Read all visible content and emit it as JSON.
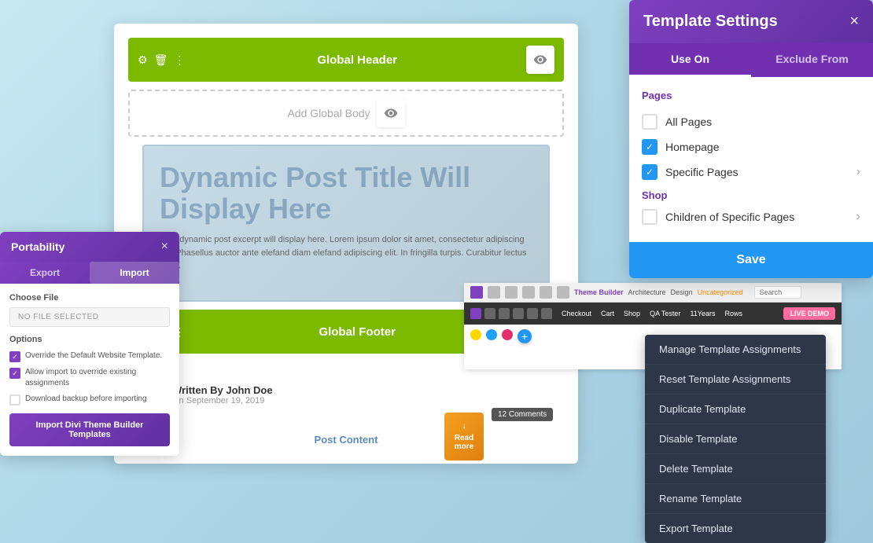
{
  "canvas": {
    "bg_color": "#c8e8f0"
  },
  "builder_card": {
    "rows": [
      {
        "id": "header",
        "label": "Global Header",
        "active": true
      },
      {
        "id": "body",
        "label": "Add Global Body",
        "active": false
      },
      {
        "id": "footer",
        "label": "Global Footer",
        "active": true
      }
    ],
    "dynamic_title": "Dynamic Post Title Will Display Here",
    "dynamic_excerpt": "Your dynamic post excerpt will display here. Lorem ipsum dolor sit amet, consectetur adipiscing elit. Phasellus auctor ante elefand diam elefand adipiscing elit. In fringilla turpis. Curabitur lectus enim.",
    "author": {
      "name": "Written By John Doe",
      "date": "On September 19, 2019"
    },
    "post_content": "Post Content"
  },
  "portability": {
    "title": "Portability",
    "close_label": "×",
    "tabs": [
      {
        "id": "export",
        "label": "Export"
      },
      {
        "id": "import",
        "label": "Import"
      }
    ],
    "file_section_label": "Choose File",
    "file_placeholder": "NO FILE SELECTED",
    "options_label": "Options",
    "options": [
      {
        "id": "override",
        "label": "Override the Default Website Template.",
        "checked": true
      },
      {
        "id": "allow_import",
        "label": "Allow import to override existing assignments",
        "checked": true
      },
      {
        "id": "download_backup",
        "label": "Download backup before importing",
        "checked": false
      }
    ],
    "import_btn_label": "Import Divi Theme Builder Templates"
  },
  "template_settings": {
    "title": "Template Settings",
    "close_label": "×",
    "tabs": [
      {
        "id": "use_on",
        "label": "Use On",
        "active": true
      },
      {
        "id": "exclude_from",
        "label": "Exclude From",
        "active": false
      }
    ],
    "pages_section": "Pages",
    "pages": [
      {
        "id": "all_pages",
        "label": "All Pages",
        "checked": false
      },
      {
        "id": "homepage",
        "label": "Homepage",
        "checked": true
      },
      {
        "id": "specific_pages",
        "label": "Specific Pages",
        "checked": true,
        "has_arrow": true
      }
    ],
    "shop_section": "Shop",
    "shop_items": [
      {
        "id": "children_specific",
        "label": "Children of Specific Pages",
        "checked": false,
        "has_arrow": true
      }
    ],
    "save_btn": "Save"
  },
  "context_menu": {
    "items": [
      {
        "id": "manage_assignments",
        "label": "Manage Template Assignments"
      },
      {
        "id": "reset_assignments",
        "label": "Reset Template Assignments"
      },
      {
        "id": "duplicate",
        "label": "Duplicate Template"
      },
      {
        "id": "disable",
        "label": "Disable Template"
      },
      {
        "id": "delete",
        "label": "Delete Template"
      },
      {
        "id": "rename",
        "label": "Rename Template"
      },
      {
        "id": "export",
        "label": "Export Template"
      }
    ]
  },
  "demo_bar": {
    "nav_icons": [
      "home-icon",
      "theme-builder-label",
      "architecture-label",
      "design-label",
      "uncategorized-label"
    ],
    "nav_labels": [
      "Theme Builder",
      "Architecture",
      "Design",
      "Uncategorized"
    ],
    "search_placeholder": "Search",
    "menu_items": [
      "Checkout",
      "Cart",
      "Shop",
      "QA Tester",
      "11Years",
      "Rows"
    ],
    "live_btn": "LIVE DEMO",
    "social_colors": [
      "#FFD700",
      "#1DA1F2",
      "#E1306C"
    ]
  },
  "read_more": {
    "arrow": "↓",
    "label": "Read more"
  },
  "comments": {
    "label": "12 Comments"
  }
}
